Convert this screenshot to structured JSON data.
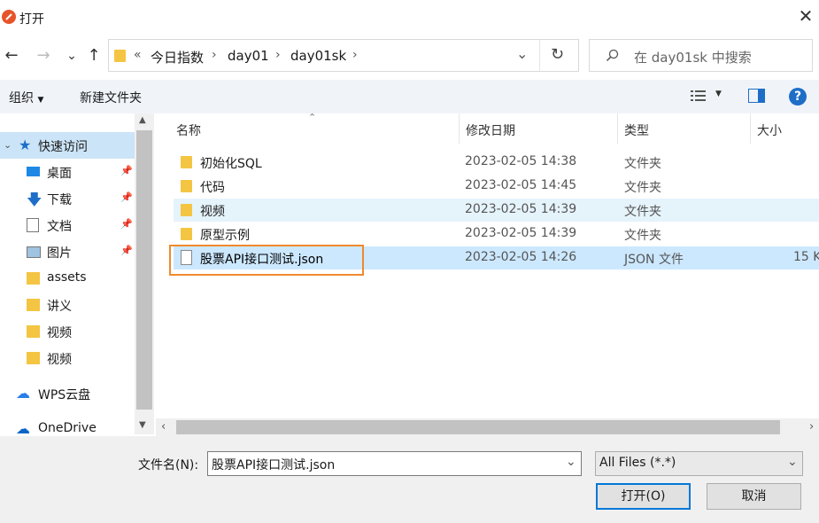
{
  "window": {
    "title": "打开",
    "close": "✕"
  },
  "nav": {
    "back": "←",
    "forward": "→",
    "recent": "⌄",
    "up": "↑",
    "refresh": "↻"
  },
  "address": {
    "overflow": "«",
    "crumbs": [
      "今日指数",
      "day01",
      "day01sk"
    ],
    "sep": "›",
    "dropdown": "⌄"
  },
  "search": {
    "placeholder": "在 day01sk 中搜索"
  },
  "toolbar": {
    "organize": "组织",
    "new_folder": "新建文件夹",
    "help": "?"
  },
  "sidebar": {
    "items": [
      {
        "label": "快速访问"
      },
      {
        "label": "桌面"
      },
      {
        "label": "下载"
      },
      {
        "label": "文档"
      },
      {
        "label": "图片"
      },
      {
        "label": "assets"
      },
      {
        "label": "讲义"
      },
      {
        "label": "视频"
      },
      {
        "label": "视频"
      },
      {
        "label": "WPS云盘"
      },
      {
        "label": "OneDrive"
      }
    ]
  },
  "columns": {
    "name": "名称",
    "date": "修改日期",
    "type": "类型",
    "size": "大小"
  },
  "files": [
    {
      "name": "初始化SQL",
      "date": "2023-02-05 14:38",
      "type": "文件夹",
      "size": ""
    },
    {
      "name": "代码",
      "date": "2023-02-05 14:45",
      "type": "文件夹",
      "size": ""
    },
    {
      "name": "视频",
      "date": "2023-02-05 14:39",
      "type": "文件夹",
      "size": ""
    },
    {
      "name": "原型示例",
      "date": "2023-02-05 14:39",
      "type": "文件夹",
      "size": ""
    },
    {
      "name": "股票API接口测试.json",
      "date": "2023-02-05 14:26",
      "type": "JSON 文件",
      "size": "15 K"
    }
  ],
  "footer": {
    "filename_label": "文件名(N):",
    "filename_value": "股票API接口测试.json",
    "filetype": "All Files (*.*)",
    "open": "打开(O)",
    "cancel": "取消"
  },
  "colors": {
    "accent": "#0078d7",
    "highlight_border": "#f08a2d",
    "selected_row": "#cce8ff",
    "folder": "#f4c542"
  }
}
